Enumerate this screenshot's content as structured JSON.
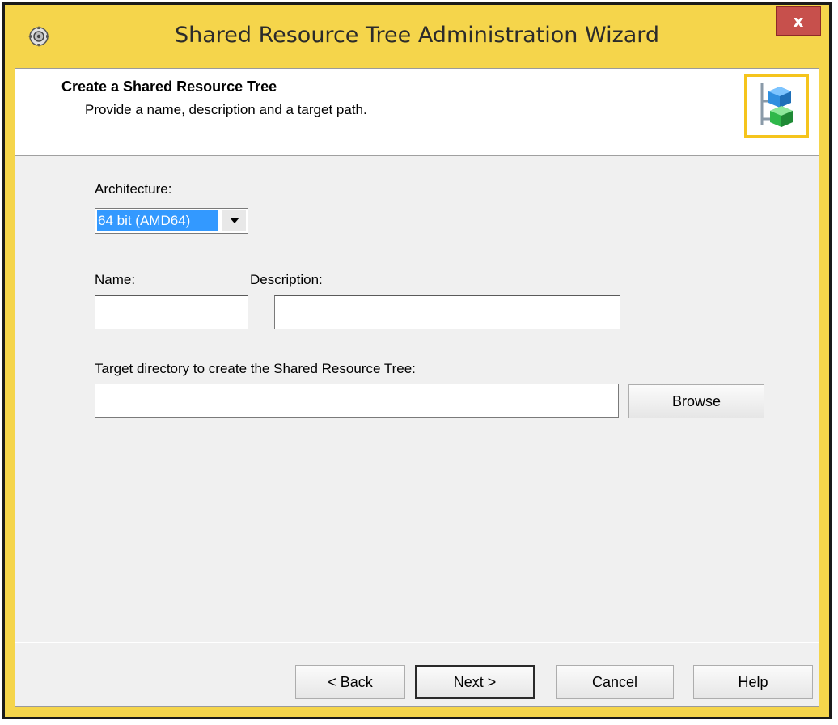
{
  "window": {
    "title": "Shared Resource Tree Administration Wizard",
    "close_label": "x"
  },
  "header": {
    "title": "Create a Shared Resource Tree",
    "subtitle": "Provide a name, description and a target path."
  },
  "form": {
    "architecture_label": "Architecture:",
    "architecture_value": "64 bit (AMD64)",
    "name_label": "Name:",
    "name_value": "",
    "description_label": "Description:",
    "description_value": "",
    "target_label": "Target directory to create the Shared Resource Tree:",
    "target_value": "",
    "browse_label": "Browse"
  },
  "footer": {
    "back_label": "< Back",
    "next_label": "Next >",
    "cancel_label": "Cancel",
    "help_label": "Help"
  },
  "colors": {
    "titlebar": "#f5d54b",
    "close": "#c7504c",
    "selection": "#3399ff",
    "logo_border": "#f5c41c"
  },
  "icons": {
    "app": "gear-cd-icon",
    "logo": "shared-resource-tree-icon",
    "dropdown": "chevron-down-icon"
  }
}
